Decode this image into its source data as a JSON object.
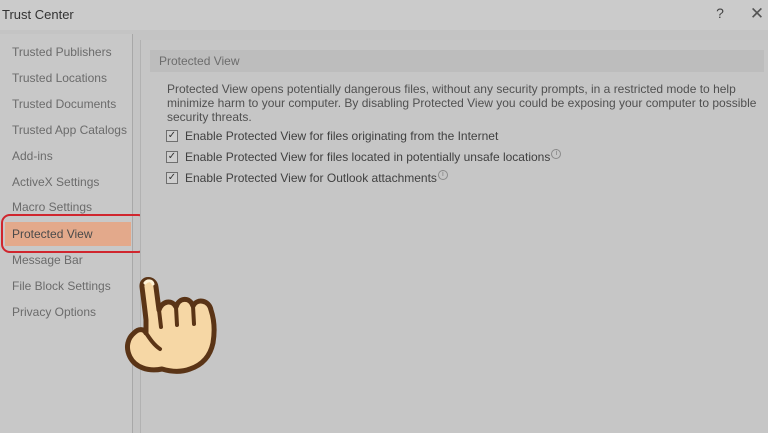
{
  "window": {
    "title": "Trust Center",
    "help_label": "?",
    "close_label": "✕"
  },
  "sidebar": {
    "items": [
      {
        "label": "Trusted Publishers"
      },
      {
        "label": "Trusted Locations"
      },
      {
        "label": "Trusted Documents"
      },
      {
        "label": "Trusted App Catalogs"
      },
      {
        "label": "Add-ins"
      },
      {
        "label": "ActiveX Settings"
      },
      {
        "label": "Macro Settings"
      },
      {
        "label": "Protected View"
      },
      {
        "label": "Message Bar"
      },
      {
        "label": "File Block Settings"
      },
      {
        "label": "Privacy Options"
      }
    ],
    "selected": "Protected View"
  },
  "panel": {
    "section_title": "Protected View",
    "description": "Protected View opens potentially dangerous files, without any security prompts, in a restricted mode to help minimize harm to your computer. By disabling Protected View you could be exposing your computer to possible security threats.",
    "options": [
      {
        "label": "Enable Protected View for files originating from the Internet",
        "checked": true
      },
      {
        "label": "Enable Protected View for files located in potentially unsafe locations",
        "checked": true
      },
      {
        "label": "Enable Protected View for Outlook attachments",
        "checked": true
      }
    ]
  },
  "overlay": {
    "highlight_color": "#d0262e",
    "selection_color": "#e3a98b",
    "pointer_icon": "pointing-hand-icon"
  }
}
